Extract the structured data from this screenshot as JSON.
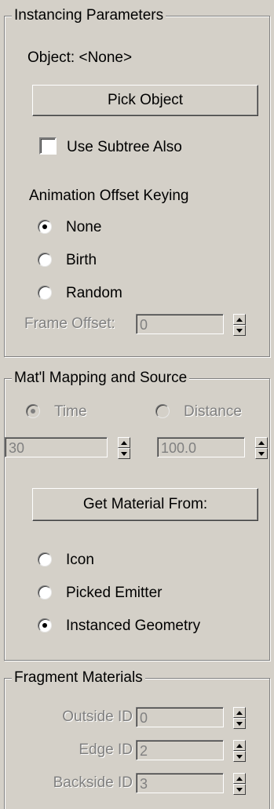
{
  "instancing": {
    "title": "Instancing Parameters",
    "object_label": "Object: <None>",
    "pick_button": "Pick Object",
    "subtree_label": "Use Subtree Also",
    "subtree_checked": false,
    "anim_heading": "Animation Offset Keying",
    "options": [
      "None",
      "Birth",
      "Random"
    ],
    "selected": "None",
    "frame_offset_label": "Frame Offset:",
    "frame_offset_value": "0"
  },
  "mapping": {
    "title": "Mat'l Mapping and Source",
    "time_label": "Time",
    "distance_label": "Distance",
    "time_value": "30",
    "distance_value": "100.0",
    "get_material_button": "Get Material From:",
    "sources": [
      "Icon",
      "Picked Emitter",
      "Instanced Geometry"
    ],
    "selected_source": "Instanced Geometry"
  },
  "fragment": {
    "title": "Fragment Materials",
    "outside_label": "Outside ID",
    "outside_value": "0",
    "edge_label": "Edge ID",
    "edge_value": "2",
    "backside_label": "Backside ID",
    "backside_value": "3"
  }
}
